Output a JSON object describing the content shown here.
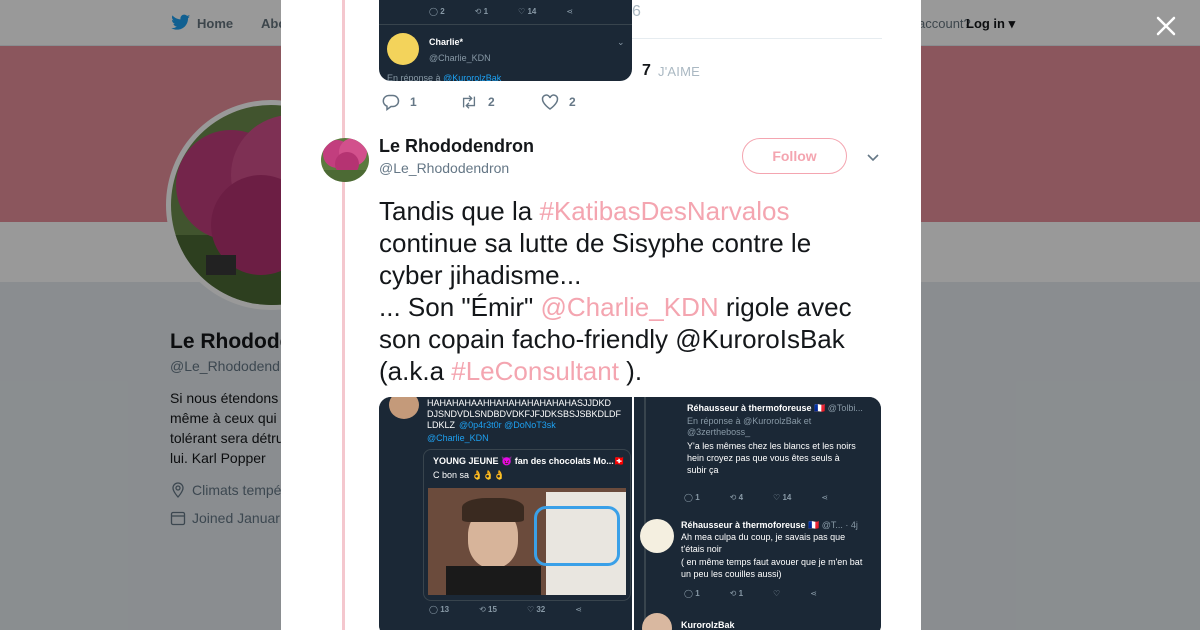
{
  "nav": {
    "home": "Home",
    "about": "Abo",
    "have_account": "account?",
    "login": "Log in"
  },
  "profile": {
    "name": "Le Rhodode",
    "handle": "@Le_Rhododendr",
    "bio": [
      "Si nous étendons",
      "même à ceux qui",
      "tolérant sera détru",
      "lui. Karl Popper"
    ],
    "location": "Climats tempé",
    "joined": "Joined Januar"
  },
  "previous_tweet": {
    "partial_count": "6",
    "likes_count": "7",
    "likes_label": "J'AIME",
    "replies": "1",
    "retweets": "2",
    "likes": "2",
    "embedded": {
      "reply_count": "2",
      "retweet_count": "1",
      "like_count": "14",
      "user_name": "Charlie*",
      "user_handle": "@Charlie_KDN",
      "reply_to_prefix": "En réponse à",
      "reply_to_handle": "@KurorolzBak"
    }
  },
  "tweet": {
    "name": "Le Rhododendron",
    "handle": "@Le_Rhododendron",
    "follow_label": "Follow",
    "text": {
      "p1": "Tandis que la ",
      "hashtag1": "#KatibasDesNarvalos",
      "p2": "continue sa lutte de Sisyphe contre le",
      "p3": "cyber jihadisme...",
      "p4": "... Son \"Émir\" ",
      "mention1": "@Charlie_KDN",
      "p5": " rigole avec",
      "p6": "son copain facho-friendly @KuroroIsBak",
      "p7": "(a.k.a ",
      "hashtag2": "#LeConsultant",
      "p8": " )."
    }
  },
  "media_left": {
    "line1": "HAHAHAHAAHHAHAHAHAHAHAHASJJDKD",
    "line2": "DJSNDVDLSNDBDVDKFJFJDKSBSJSBKDLDF",
    "line3": "LDKLZ",
    "mention_a": "@0p4r3t0r @DoNoT3sk",
    "mention_b": "@Charlie_KDN",
    "quote_user": "YOUNG JEUNE 😈 fan des chocolats Mo...🇨🇭",
    "quote_text": "C bon sa 👌👌👌",
    "replies": "13",
    "retweets": "15",
    "likes": "32"
  },
  "media_right": {
    "user1": "Réhausseur à thermoforeuse 🇫🇷",
    "user1_handle": "@Tolbi...",
    "reply_prefix": "En réponse à",
    "reply_handles_a": "@KurorolzBak",
    "reply_and": "et",
    "reply_handles_b": "@3zertheboss_",
    "text1_a": "Y'a les mêmes chez les blancs et les noirs",
    "text1_b": "hein croyez pas que vous êtes seuls à",
    "text1_c": "subir ça",
    "r1": "1",
    "rt1": "4",
    "l1": "14",
    "user2": "Réhausseur à thermoforeuse 🇫🇷",
    "user2_meta": "@T... · 4j",
    "text2_a": "Ah mea culpa du coup, je savais pas que",
    "text2_b": "t'étais noir",
    "text2_c": "( en même temps faut avouer que je m'en bat",
    "text2_d": "un peu les couilles aussi)",
    "r2": "1",
    "rt2": "1",
    "user3": "KurorolzBak"
  },
  "colors": {
    "accent": "#f4a5b0",
    "banner": "#e8909c",
    "dark_card": "#1b2836",
    "twitter_blue": "#1da1f2"
  }
}
